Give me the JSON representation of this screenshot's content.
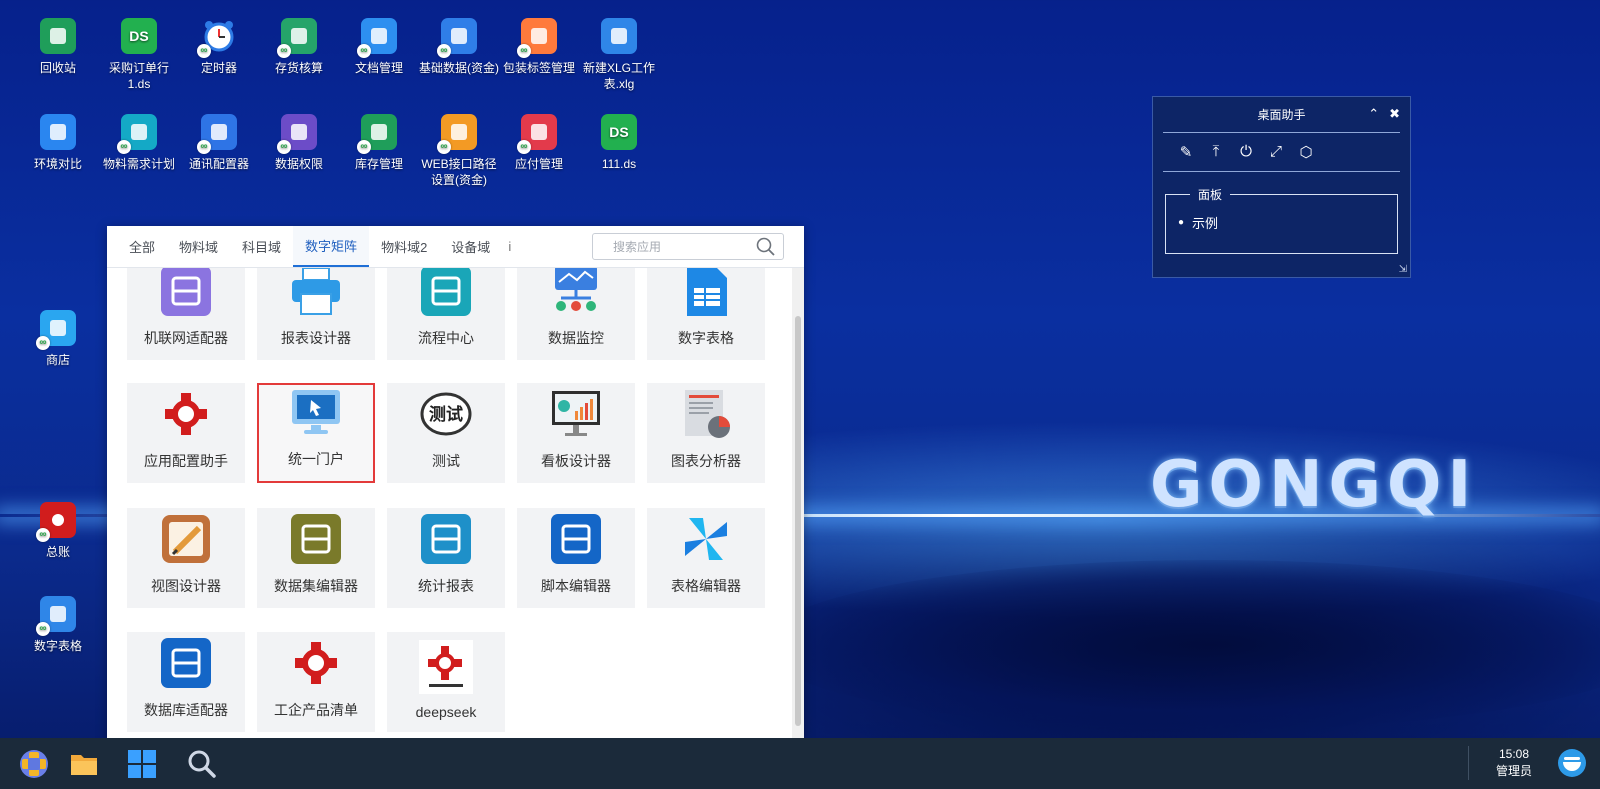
{
  "desktop": {
    "brand_text": "GONGQI",
    "icons": [
      {
        "label": "回收站",
        "icon": "recycle-bin-icon",
        "color": "#1f9e5a"
      },
      {
        "label": "采购订单行1.ds",
        "icon": "ds-file-icon",
        "color": "#22b04f"
      },
      {
        "label": "定时器",
        "icon": "alarm-clock-icon",
        "color": "#ffffff"
      },
      {
        "label": "存货核算",
        "icon": "house-icon",
        "color": "#25a46a"
      },
      {
        "label": "文档管理",
        "icon": "folder-doc-icon",
        "color": "#2d8ff0"
      },
      {
        "label": "基础数据(资金)",
        "icon": "settings-card-icon",
        "color": "#2f7ee8"
      },
      {
        "label": "包装标签管理",
        "icon": "package-icon",
        "color": "#ff7a3c"
      },
      {
        "label": "新建XLG工作表.xlg",
        "icon": "pinwheel-file-icon",
        "color": "#2f86e8"
      },
      {
        "label": "环境对比",
        "icon": "compare-icon",
        "color": "#2a86f0"
      },
      {
        "label": "物料需求计划",
        "icon": "m-circle-icon",
        "color": "#14a9c6"
      },
      {
        "label": "通讯配置器",
        "icon": "chat-icon",
        "color": "#2e74e6"
      },
      {
        "label": "数据权限",
        "icon": "lock-icon",
        "color": "#6c4cc8"
      },
      {
        "label": "库存管理",
        "icon": "warehouse-icon",
        "color": "#1f9e5a"
      },
      {
        "label": "WEB接口路径设置(资金)",
        "icon": "link-chain-icon",
        "color": "#f39a24"
      },
      {
        "label": "应付管理",
        "icon": "yen-icon",
        "color": "#e33a4b"
      },
      {
        "label": "111.ds",
        "icon": "ds-file-icon",
        "color": "#22b04f"
      },
      {
        "label": "商店",
        "icon": "shop-bag-icon",
        "color": "#2aa6f0"
      },
      {
        "label": "总账",
        "icon": "gear-cross-icon",
        "color": "#d11d1d"
      },
      {
        "label": "数字表格",
        "icon": "spreadsheet-icon",
        "color": "#2f86e8"
      }
    ]
  },
  "assistant": {
    "title": "桌面助手",
    "group_label": "面板",
    "item_label": "示例"
  },
  "launcher": {
    "tabs": [
      "全部",
      "物料域",
      "科目域",
      "数字矩阵",
      "物料域2",
      "设备域"
    ],
    "active_tab": "数字矩阵",
    "more_glyph": "i",
    "search_placeholder": "搜索应用",
    "apps": [
      {
        "label": "机联网适配器",
        "icon": "machine-network-icon",
        "color": "#8b74e0"
      },
      {
        "label": "报表设计器",
        "icon": "printer-icon",
        "color": "#3aa0e6"
      },
      {
        "label": "流程中心",
        "icon": "flowchart-icon",
        "color": "#1aa6b8"
      },
      {
        "label": "数据监控",
        "icon": "monitor-chart-icon",
        "color": "#3a7fe0"
      },
      {
        "label": "数字表格",
        "icon": "spreadsheet-icon",
        "color": "#2f86e8"
      },
      {
        "label": "应用配置助手",
        "icon": "gear-cross-icon",
        "color": "#d11d1d"
      },
      {
        "label": "统一门户",
        "icon": "desktop-pointer-icon",
        "color": "#4aa3ea",
        "selected": true
      },
      {
        "label": "测试",
        "icon": "test-stamp-icon",
        "color": "#333333"
      },
      {
        "label": "看板设计器",
        "icon": "dashboard-screen-icon",
        "color": "#3b3b3b"
      },
      {
        "label": "图表分析器",
        "icon": "report-chart-icon",
        "color": "#8a8a8a"
      },
      {
        "label": "视图设计器",
        "icon": "pencil-paper-icon",
        "color": "#c0703a"
      },
      {
        "label": "数据集编辑器",
        "icon": "dataset-icon",
        "color": "#7a7a2a"
      },
      {
        "label": "统计报表",
        "icon": "ruler-pencil-icon",
        "color": "#1e90c9"
      },
      {
        "label": "脚本编辑器",
        "icon": "code-window-icon",
        "color": "#1466c7"
      },
      {
        "label": "表格编辑器",
        "icon": "pinwheel-icon",
        "color": "#1f8fe0"
      },
      {
        "label": "数据库适配器",
        "icon": "usb-icon",
        "color": "#1466c7"
      },
      {
        "label": "工企产品清单",
        "icon": "gear-cross-icon",
        "color": "#d11d1d"
      },
      {
        "label": "deepseek",
        "icon": "deepseek-logo-icon",
        "color": "#d11d1d"
      }
    ]
  },
  "taskbar": {
    "time": "15:08",
    "user": "管理员"
  }
}
